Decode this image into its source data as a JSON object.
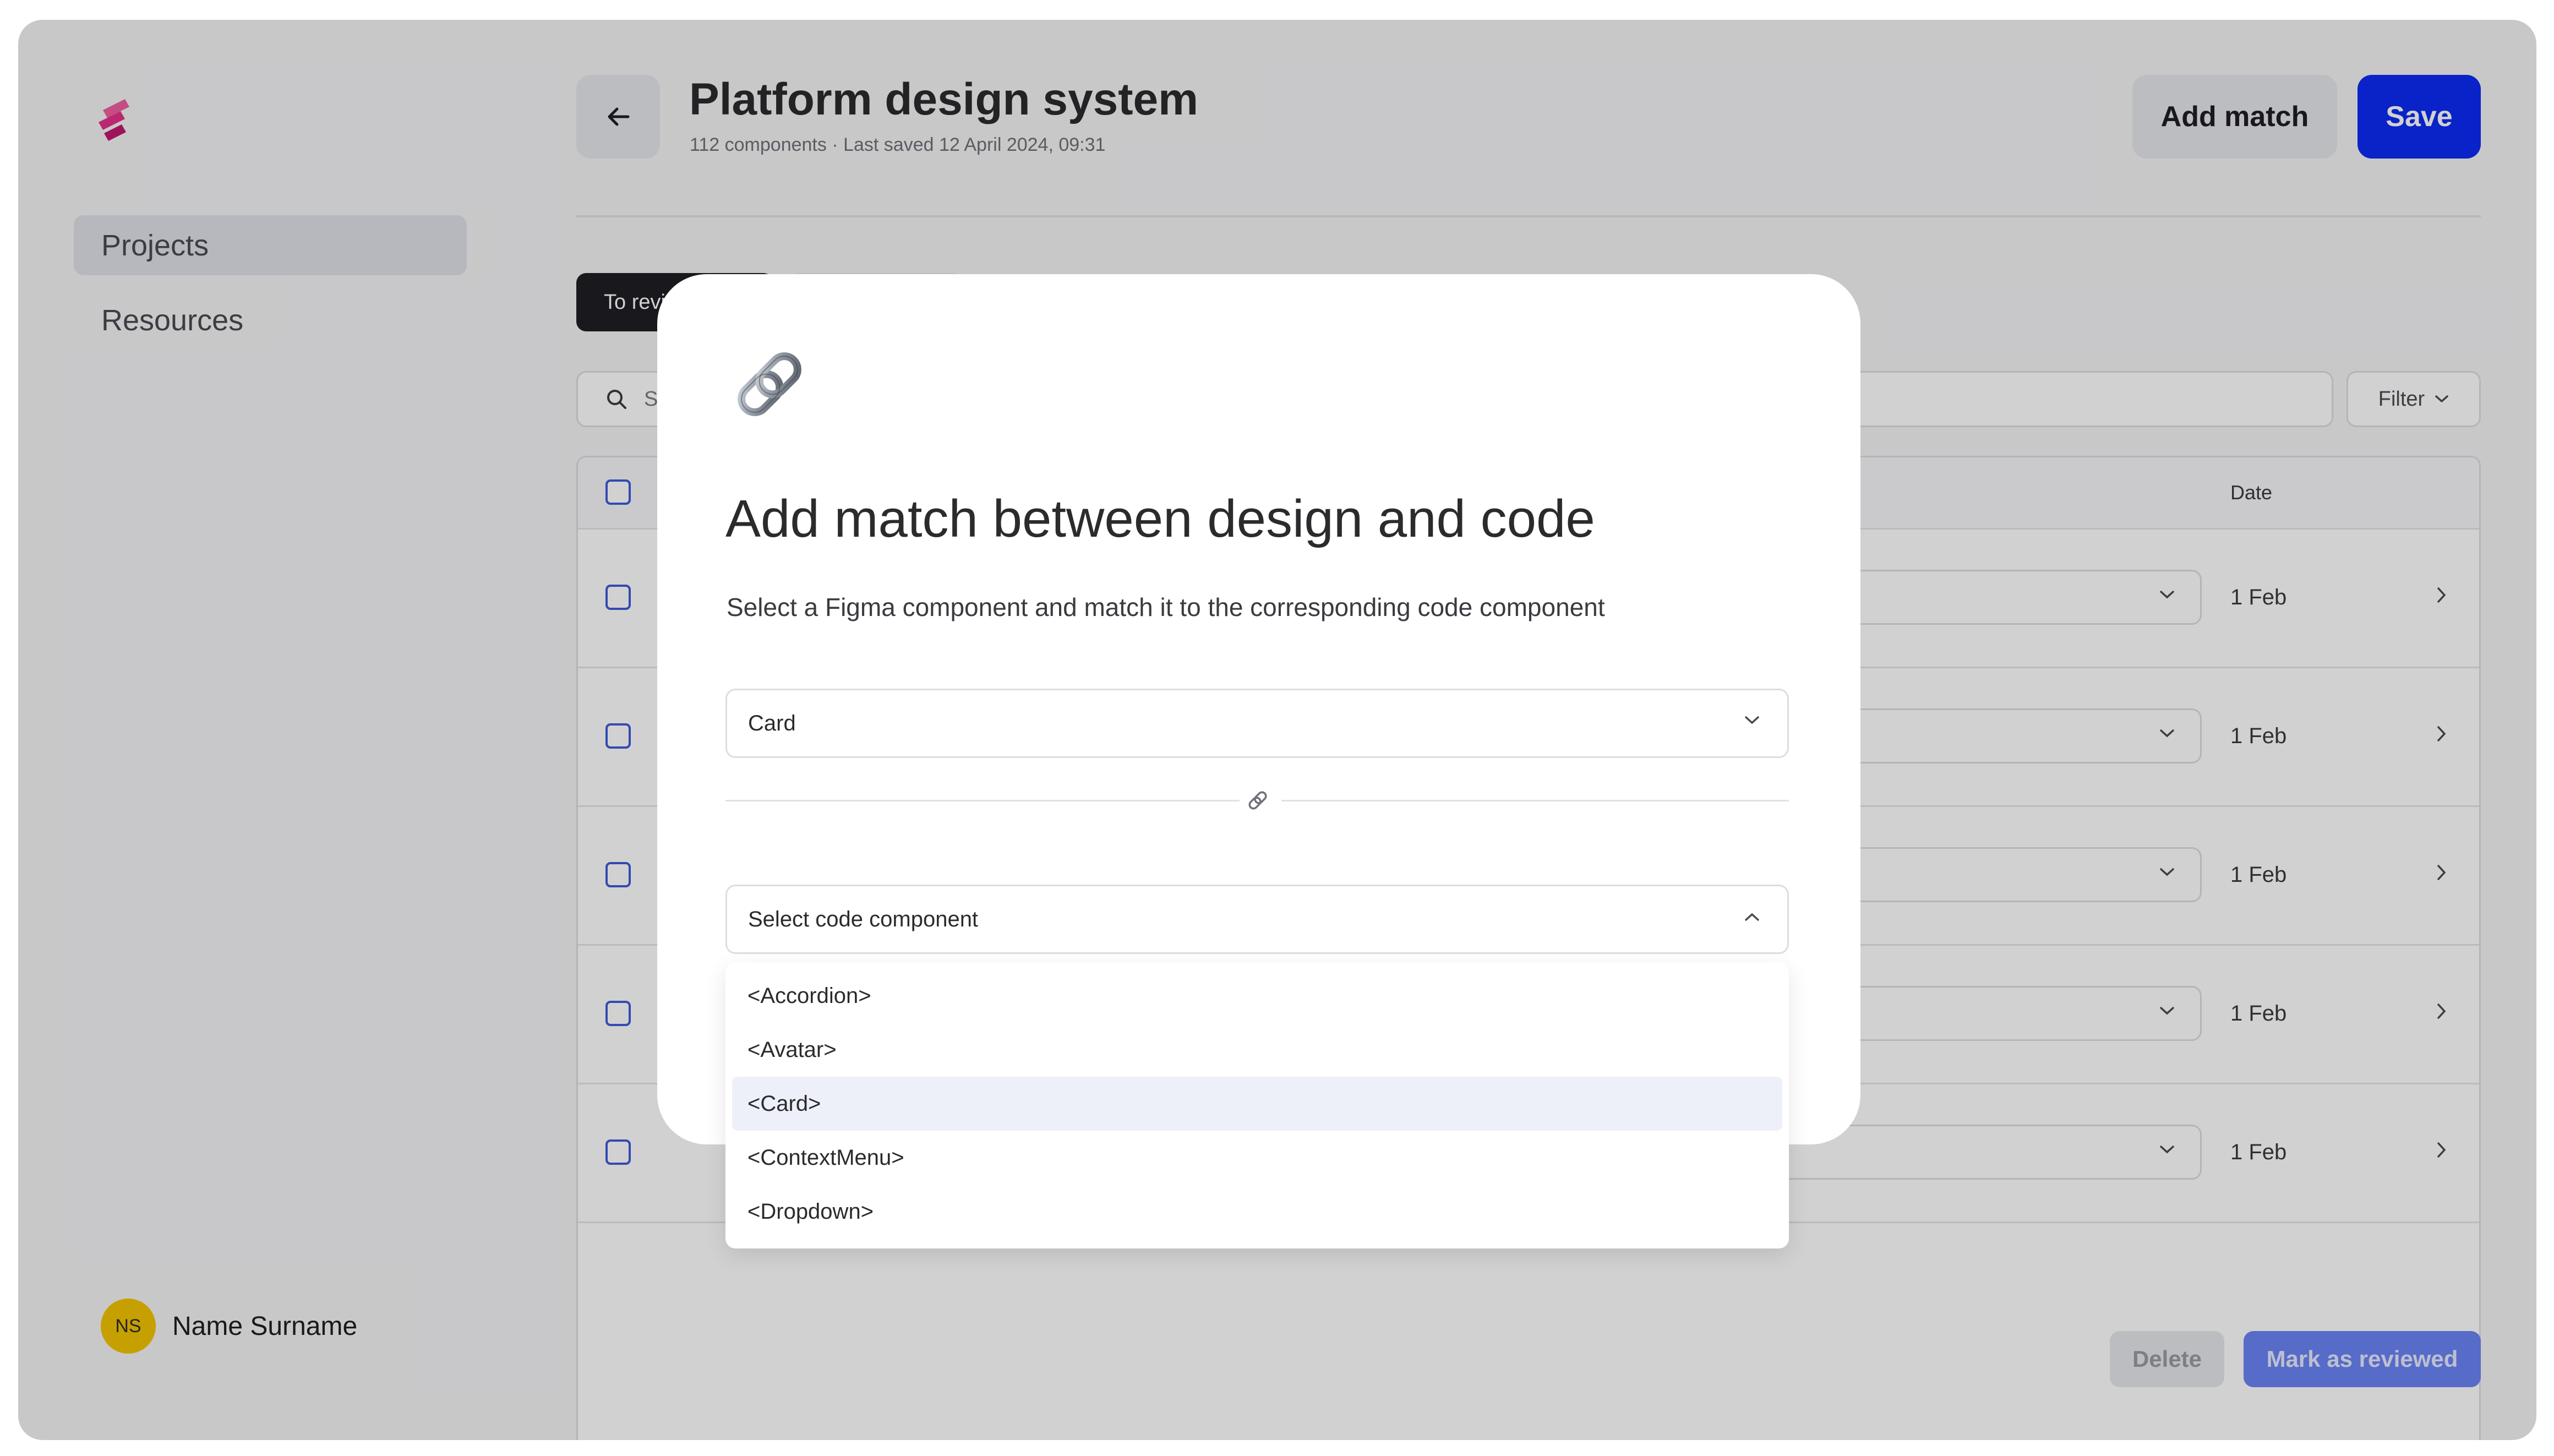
{
  "sidebar": {
    "items": [
      {
        "label": "Projects",
        "active": true
      },
      {
        "label": "Resources",
        "active": false
      }
    ],
    "user": {
      "initials": "NS",
      "name": "Name Surname"
    }
  },
  "header": {
    "title": "Platform design system",
    "subtitle": "112 components · Last saved 12 April 2024, 09:31",
    "add_match_label": "Add match",
    "save_label": "Save"
  },
  "tabs": [
    {
      "label": "To review"
    },
    {
      "label": ""
    }
  ],
  "search": {
    "placeholder": "Se"
  },
  "filter": {
    "label": "Filter"
  },
  "table": {
    "date_header": "Date",
    "rows": [
      {
        "date": "1 Feb"
      },
      {
        "date": "1 Feb"
      },
      {
        "date": "1 Feb"
      },
      {
        "date": "1 Feb"
      },
      {
        "date": "1 Feb"
      }
    ]
  },
  "bottom_bar": {
    "delete_label": "Delete",
    "mark_reviewed_label": "Mark as reviewed"
  },
  "modal": {
    "icon": "link-icon",
    "title": "Add match between design and code",
    "description": "Select a Figma component and match it to the corresponding code component",
    "figma_select_value": "Card",
    "code_select_placeholder": "Select code component",
    "options": [
      {
        "label": "<Accordion>",
        "highlighted": false
      },
      {
        "label": "<Avatar>",
        "highlighted": false
      },
      {
        "label": "<Card>",
        "highlighted": true
      },
      {
        "label": "<ContextMenu>",
        "highlighted": false
      },
      {
        "label": "<Dropdown>",
        "highlighted": false
      }
    ]
  },
  "colors": {
    "primary": "#0b2bf5",
    "badge": "#f2552c",
    "avatar": "#f2c400",
    "highlight": "#eef0f9"
  }
}
